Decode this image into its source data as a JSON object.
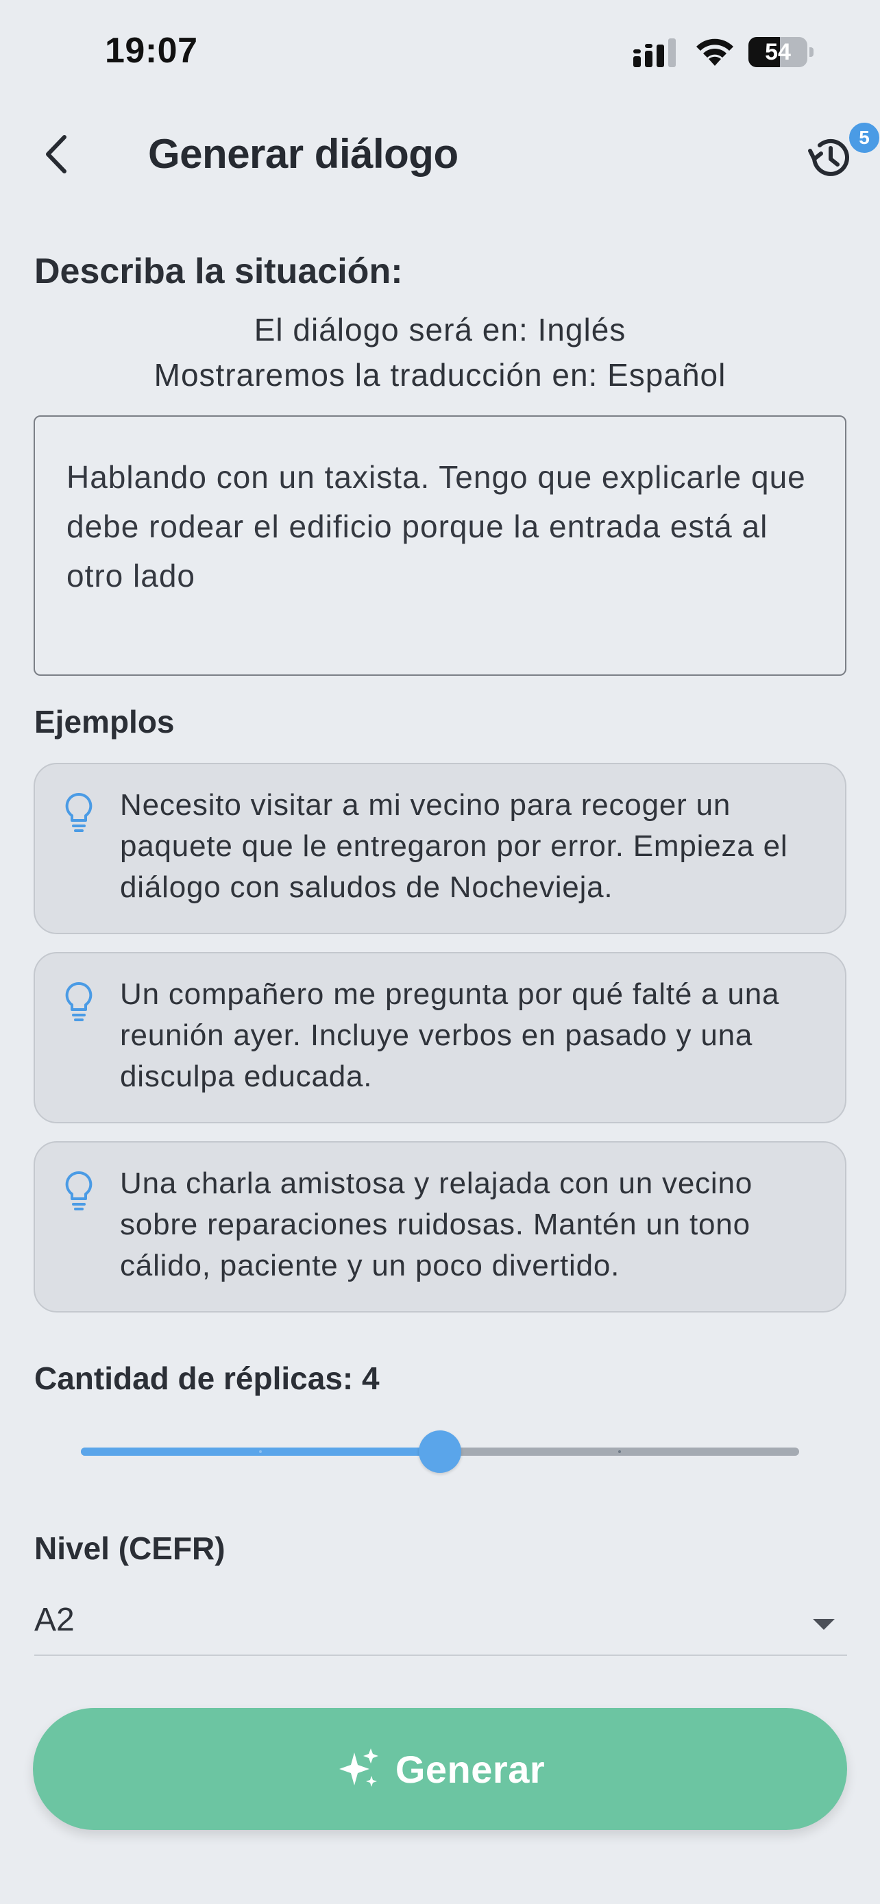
{
  "status_bar": {
    "time": "19:07",
    "battery_level": "54",
    "icons": [
      "signal-icon",
      "wifi-icon",
      "battery-icon"
    ]
  },
  "header": {
    "title": "Generar diálogo",
    "back_icon": "chevron-left-icon",
    "history_icon": "history-icon",
    "history_badge": "5"
  },
  "situation": {
    "heading": "Describa la situación:",
    "dialog_language_line": "El diálogo será en: Inglés",
    "translation_language_line": "Mostraremos la traducción en: Español",
    "text_value": "Hablando con un taxista. Tengo que explicarle que debe rodear el edificio porque la entrada está al otro lado"
  },
  "examples": {
    "heading": "Ejemplos",
    "icon": "lightbulb-icon",
    "items": [
      {
        "text": "Necesito visitar a mi vecino para recoger un paquete que le entregaron por error. Empieza el diálogo con saludos de Nochevieja."
      },
      {
        "text": "Un compañero me pregunta por qué falté a una reunión ayer. Incluye verbos en pasado y una disculpa educada."
      },
      {
        "text": "Una charla amistosa y relajada con un vecino sobre reparaciones ruidosas. Mantén un tono cálido, paciente y un poco divertido."
      }
    ]
  },
  "replicas": {
    "label": "Cantidad de réplicas: 4",
    "value": 4,
    "min": 2,
    "max": 6,
    "step": 1
  },
  "level": {
    "label": "Nivel (CEFR)",
    "selected": "A2"
  },
  "generate": {
    "label": "Generar",
    "icon": "sparkle-icon"
  },
  "colors": {
    "background": "#e9ecf0",
    "accent_blue": "#5aa5ea",
    "generate_green": "#6cc5a2",
    "card_background": "#dcdfe4"
  }
}
